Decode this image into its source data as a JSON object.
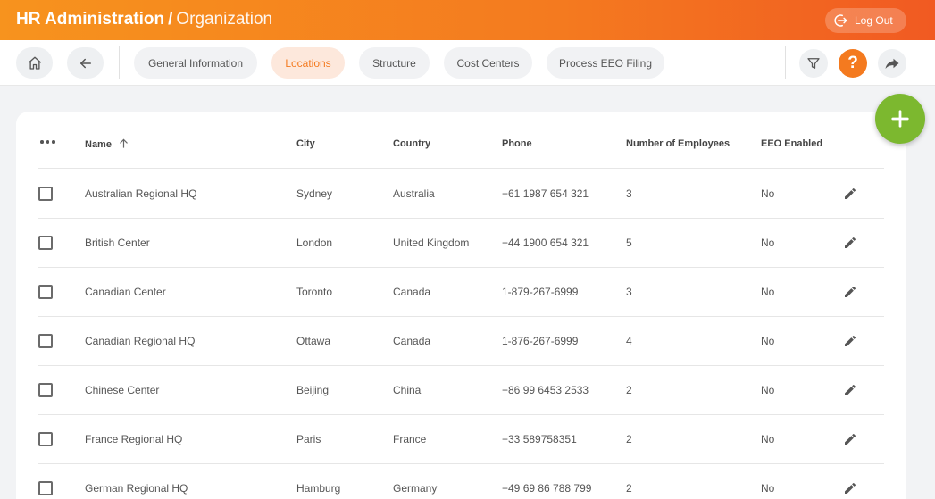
{
  "header": {
    "title": "HR Administration",
    "separator": "/",
    "subtitle": "Organization",
    "logout_label": "Log Out"
  },
  "nav": {
    "tabs": [
      {
        "label": "General Information",
        "active": false
      },
      {
        "label": "Locations",
        "active": true
      },
      {
        "label": "Structure",
        "active": false
      },
      {
        "label": "Cost Centers",
        "active": false
      },
      {
        "label": "Process EEO Filing",
        "active": false
      }
    ],
    "help_label": "?"
  },
  "colors": {
    "brand_orange": "#f47a1f",
    "add_green": "#7cb82f"
  },
  "table": {
    "columns": [
      "Name",
      "City",
      "Country",
      "Phone",
      "Number of Employees",
      "EEO Enabled"
    ],
    "sorted_column": "Name",
    "rows": [
      [
        "Australian Regional HQ",
        "Sydney",
        "Australia",
        "+61 1987 654 321",
        "3",
        "No"
      ],
      [
        "British Center",
        "London",
        "United Kingdom",
        "+44 1900 654 321",
        "5",
        "No"
      ],
      [
        "Canadian Center",
        "Toronto",
        "Canada",
        "1-879-267-6999",
        "3",
        "No"
      ],
      [
        "Canadian Regional HQ",
        "Ottawa",
        "Canada",
        "1-876-267-6999",
        "4",
        "No"
      ],
      [
        "Chinese Center",
        "Beijing",
        "China",
        "+86 99 6453 2533",
        "2",
        "No"
      ],
      [
        "France Regional HQ",
        "Paris",
        "France",
        "+33 589758351",
        "2",
        "No"
      ],
      [
        "German Regional HQ",
        "Hamburg",
        "Germany",
        "+49 69 86 788 799",
        "2",
        "No"
      ]
    ]
  }
}
